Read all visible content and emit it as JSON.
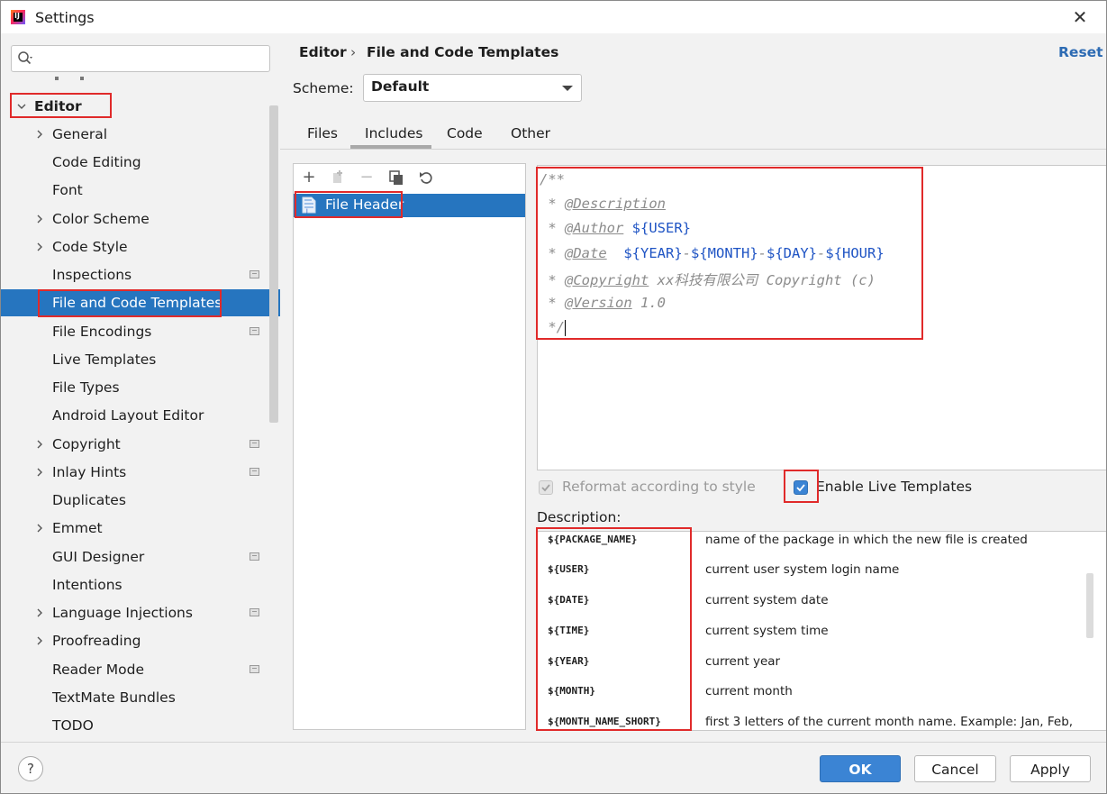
{
  "window": {
    "title": "Settings"
  },
  "sidebar": {
    "search_placeholder": "",
    "items": [
      {
        "label": "Editor",
        "level": 0,
        "expanded": true
      },
      {
        "label": "General",
        "level": 1,
        "expandable": true
      },
      {
        "label": "Code Editing",
        "level": 1
      },
      {
        "label": "Font",
        "level": 1
      },
      {
        "label": "Color Scheme",
        "level": 1,
        "expandable": true
      },
      {
        "label": "Code Style",
        "level": 1,
        "expandable": true
      },
      {
        "label": "Inspections",
        "level": 1,
        "project_icon": true
      },
      {
        "label": "File and Code Templates",
        "level": 1,
        "selected": true,
        "project_icon": true
      },
      {
        "label": "File Encodings",
        "level": 1,
        "project_icon": true
      },
      {
        "label": "Live Templates",
        "level": 1
      },
      {
        "label": "File Types",
        "level": 1
      },
      {
        "label": "Android Layout Editor",
        "level": 1
      },
      {
        "label": "Copyright",
        "level": 1,
        "expandable": true,
        "project_icon": true
      },
      {
        "label": "Inlay Hints",
        "level": 1,
        "expandable": true,
        "project_icon": true
      },
      {
        "label": "Duplicates",
        "level": 1
      },
      {
        "label": "Emmet",
        "level": 1,
        "expandable": true
      },
      {
        "label": "GUI Designer",
        "level": 1,
        "project_icon": true
      },
      {
        "label": "Intentions",
        "level": 1
      },
      {
        "label": "Language Injections",
        "level": 1,
        "expandable": true,
        "project_icon": true
      },
      {
        "label": "Proofreading",
        "level": 1,
        "expandable": true
      },
      {
        "label": "Reader Mode",
        "level": 1,
        "project_icon": true
      },
      {
        "label": "TextMate Bundles",
        "level": 1
      },
      {
        "label": "TODO",
        "level": 1
      }
    ]
  },
  "header": {
    "breadcrumb_root": "Editor",
    "breadcrumb_sep": "›",
    "breadcrumb_current": "File and Code Templates",
    "reset": "Reset"
  },
  "scheme": {
    "label": "Scheme:",
    "value": "Default"
  },
  "tabs": [
    {
      "label": "Files"
    },
    {
      "label": "Includes",
      "active": true
    },
    {
      "label": "Code"
    },
    {
      "label": "Other"
    }
  ],
  "templates_list": {
    "items": [
      "File Header"
    ]
  },
  "editor": {
    "line1": "/**",
    "line2_prefix": " * ",
    "line2_tag": "@Description",
    "line3_prefix": " * ",
    "line3_tag": "@Author",
    "line3_var": " ${USER}",
    "line4_prefix": " * ",
    "line4_tag": "@Date",
    "line4_v1": "  ${YEAR}",
    "line4_d1": "-",
    "line4_v2": "${MONTH}",
    "line4_d2": "-",
    "line4_v3": "${DAY}",
    "line4_d3": "-",
    "line4_v4": "${HOUR}",
    "line5_prefix": " * ",
    "line5_tag": "@Copyright",
    "line5_text": " xx科技有限公司 Copyright (c)",
    "line6_prefix": " * ",
    "line6_tag": "@Version",
    "line6_text": " 1.0",
    "line7": " */"
  },
  "options": {
    "reformat_label": "Reformat according to style",
    "reformat_checked": true,
    "reformat_enabled": false,
    "live_templates_label": "Enable Live Templates",
    "live_templates_checked": true
  },
  "description": {
    "label": "Description:",
    "rows": [
      {
        "var": "${PACKAGE_NAME}",
        "text": "name of the package in which the new file is created"
      },
      {
        "var": "${USER}",
        "text": "current user system login name"
      },
      {
        "var": "${DATE}",
        "text": "current system date"
      },
      {
        "var": "${TIME}",
        "text": "current system time"
      },
      {
        "var": "${YEAR}",
        "text": "current year"
      },
      {
        "var": "${MONTH}",
        "text": "current month"
      },
      {
        "var": "${MONTH_NAME_SHORT}",
        "text": "first 3 letters of the current month name. Example: Jan, Feb,"
      }
    ]
  },
  "footer": {
    "help": "?",
    "ok": "OK",
    "cancel": "Cancel",
    "apply": "Apply"
  },
  "colors": {
    "selection": "#2675bf",
    "highlight": "#e02a2a",
    "link": "#2d6bb3",
    "variable": "#1f54c4"
  }
}
